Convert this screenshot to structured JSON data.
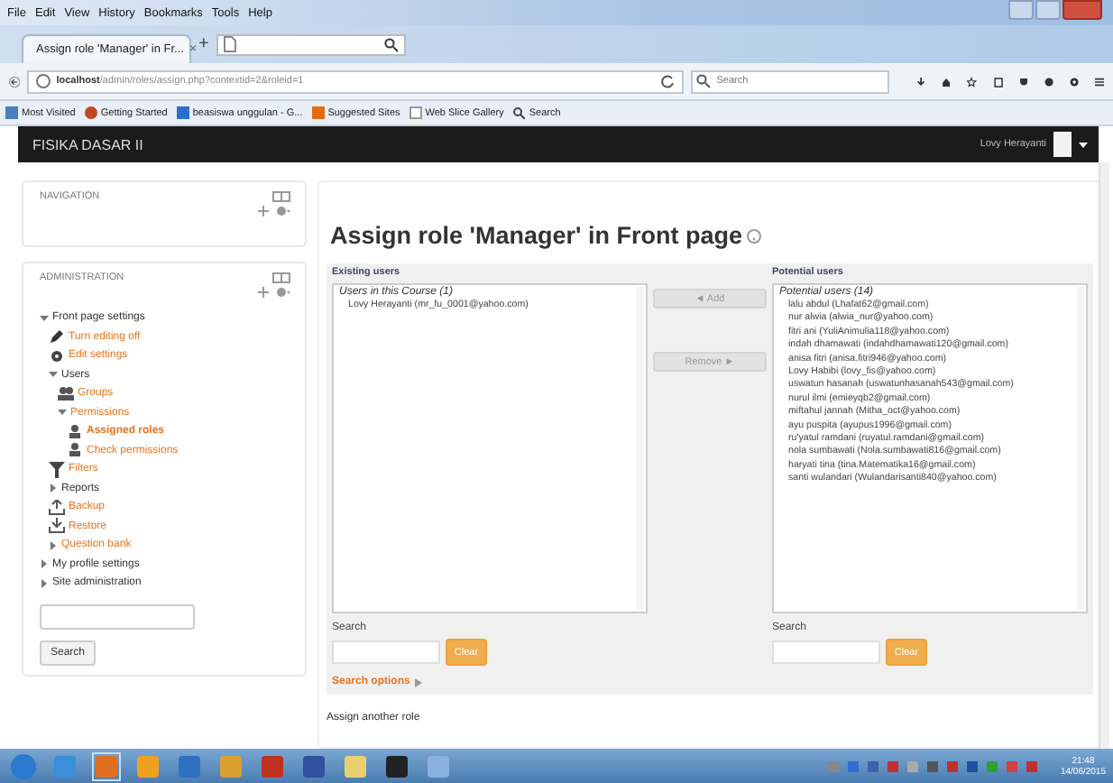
{
  "browser": {
    "menu": [
      "File",
      "Edit",
      "View",
      "History",
      "Bookmarks",
      "Tools",
      "Help"
    ],
    "tab": {
      "title": "Assign role 'Manager' in Fr...",
      "close": "×"
    },
    "new_tab": "+",
    "url_host": "localhost",
    "url_path": "/admin/roles/assign.php?contextid=2&roleid=1",
    "search": {
      "placeholder": "Search"
    },
    "bookmarks": [
      "Most Visited",
      "Getting Started",
      "beasiswa unggulan - G...",
      "Suggested Sites",
      "Web Slice Gallery",
      "Search"
    ]
  },
  "navbar": {
    "site": "FISIKA DASAR II",
    "user": "Lovy Herayanti"
  },
  "navigation": {
    "title": "NAVIGATION"
  },
  "administration": {
    "title": "ADMINISTRATION",
    "tree": [
      {
        "label": "Front page settings",
        "kind": "branch",
        "expanded": true,
        "children": [
          {
            "label": "Turn editing off",
            "kind": "edit",
            "selected": false
          },
          {
            "label": "Edit settings",
            "kind": "settings",
            "selected": false
          },
          {
            "label": "Users",
            "kind": "branch",
            "expanded": true,
            "children": [
              {
                "label": "Groups",
                "kind": "groups",
                "selected": false
              },
              {
                "label": "Permissions",
                "kind": "branchlink",
                "expanded": true,
                "children": [
                  {
                    "label": "Assigned roles",
                    "kind": "role",
                    "selected": true
                  },
                  {
                    "label": "Check permissions",
                    "kind": "role",
                    "selected": false
                  }
                ]
              }
            ]
          },
          {
            "label": "Filters",
            "kind": "filter",
            "selected": false
          },
          {
            "label": "Reports",
            "kind": "branch",
            "expanded": false
          },
          {
            "label": "Backup",
            "kind": "backup",
            "selected": false
          },
          {
            "label": "Restore",
            "kind": "restore",
            "selected": false
          },
          {
            "label": "Question bank",
            "kind": "branchlink",
            "expanded": false
          }
        ]
      },
      {
        "label": "My profile settings",
        "kind": "branch",
        "expanded": false
      },
      {
        "label": "Site administration",
        "kind": "branch",
        "expanded": false
      }
    ],
    "search_button": "Search"
  },
  "main": {
    "title": "Assign role 'Manager' in Front page",
    "existing": {
      "heading": "Existing users",
      "group": "Users in this Course (1)",
      "users": [
        "Lovy Herayanti (mr_fu_0001@yahoo.com)"
      ]
    },
    "add_button": "◄ Add",
    "remove_button": "Remove ►",
    "potential": {
      "heading": "Potential users",
      "group": "Potential users (14)",
      "users": [
        "lalu abdul (Lhafat62@gmail.com)",
        "nur alwia (alwia_nur@yahoo.com)",
        "fitri ani (YuliAnimulia118@yahoo.com)",
        "indah dhamawati (indahdhamawati120@gmail.com)",
        "anisa fitri (anisa.fitri946@yahoo.com)",
        "Lovy Habibi (lovy_fis@yahoo.com)",
        "uswatun hasanah (uswatunhasanah543@gmail.com)",
        "nurul ilmi (emieyqb2@gmail.com)",
        "miftahul jannah (Mitha_oct@yahoo.com)",
        "ayu puspita (ayupus1996@gmail.com)",
        "ru'yatul ramdani (ruyatul.ramdani@gmail.com)",
        "nola sumbawati (Nola.sumbawati816@gmail.com)",
        "haryati tina (tina.Matematika16@gmail.com)",
        "santi wulandari (Wulandarisanti840@yahoo.com)"
      ]
    },
    "search_label_left": "Search",
    "clear_left": "Clear",
    "search_label_right": "Search",
    "clear_right": "Clear",
    "search_options": "Search options",
    "assign_another": "Assign another role"
  },
  "taskbar": {
    "time": "21:48",
    "date": "14/06/2015"
  }
}
